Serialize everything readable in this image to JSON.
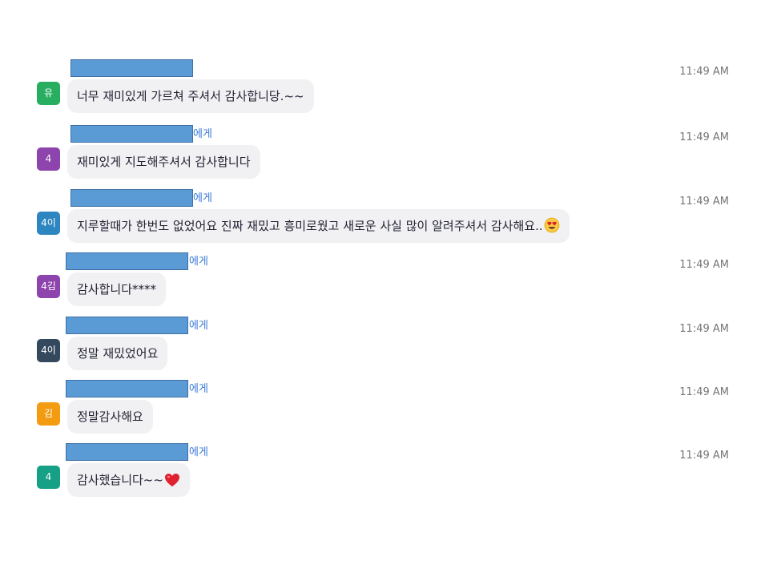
{
  "messages": [
    {
      "recipient_suffix": "",
      "time": "11:49 AM",
      "avatar": "유",
      "avatar_color": "#27ae60",
      "text": "너무 재미있게 가르쳐 주셔서 감사합니당.~~"
    },
    {
      "recipient_suffix": "에게",
      "time": "11:49 AM",
      "avatar": "4",
      "avatar_color": "#8e44ad",
      "text": "재미있게 지도해주셔서 감사합니다"
    },
    {
      "recipient_suffix": "에게",
      "time": "11:49 AM",
      "avatar": "4이",
      "avatar_color": "#2e86c1",
      "text": "지루할때가 한번도 없었어요 진짜 재밌고 흥미로웠고 새로운 사실 많이 알려주셔서 감사해요.."
    },
    {
      "recipient_suffix": "에게",
      "time": "11:49 AM",
      "avatar": "4김",
      "avatar_color": "#8e44ad",
      "text": "감사합니다****"
    },
    {
      "recipient_suffix": "에게",
      "time": "11:49 AM",
      "avatar": "4이",
      "avatar_color": "#34495e",
      "text": "정말 재밌었어요"
    },
    {
      "recipient_suffix": "에게",
      "time": "11:49 AM",
      "avatar": "김",
      "avatar_color": "#f39c12",
      "text": "정말감사해요"
    },
    {
      "recipient_suffix": "에게",
      "time": "11:49 AM",
      "avatar": "4",
      "avatar_color": "#16a085",
      "text": "감사했습니다~~"
    }
  ],
  "emojis": {
    "heart_eyes": "heart-eyes-emoji",
    "red_heart": "red-heart-emoji"
  }
}
